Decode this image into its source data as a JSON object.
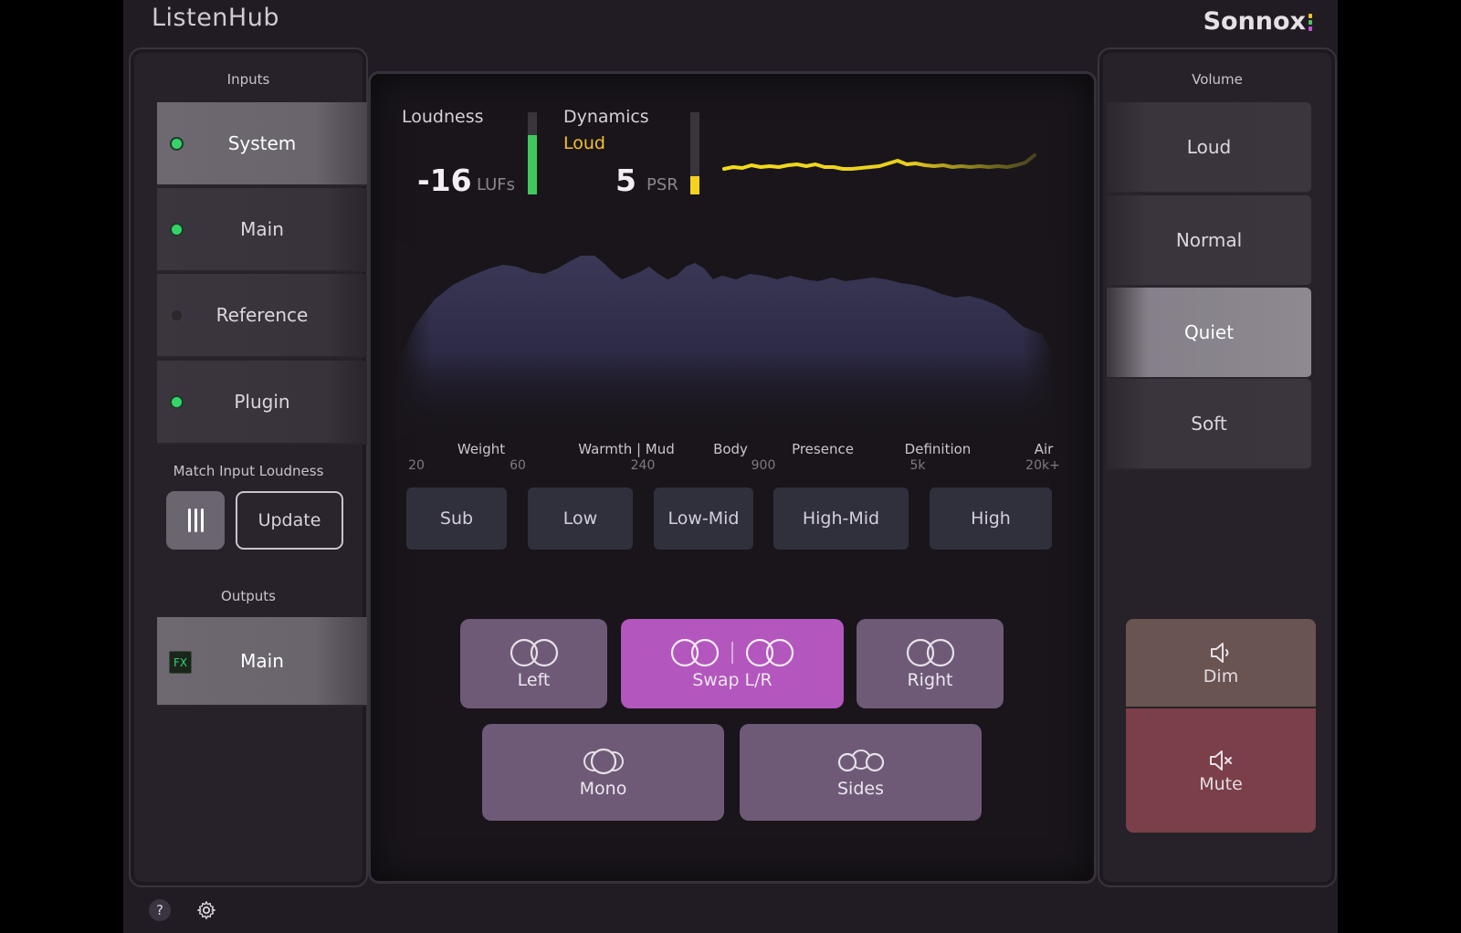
{
  "app": {
    "title": "ListenHub",
    "brand": "Sonnox",
    "brand_dot_colors": [
      "#f2c12e",
      "#4fc36a",
      "#c452d6"
    ]
  },
  "inputs": {
    "label": "Inputs",
    "items": [
      {
        "label": "System",
        "active": true,
        "indicator": "on"
      },
      {
        "label": "Main",
        "active": false,
        "indicator": "on"
      },
      {
        "label": "Reference",
        "active": false,
        "indicator": "off"
      },
      {
        "label": "Plugin",
        "active": false,
        "indicator": "on"
      }
    ]
  },
  "match": {
    "label": "Match Input Loudness",
    "update_label": "Update"
  },
  "outputs": {
    "label": "Outputs",
    "items": [
      {
        "label": "Main",
        "badge": "FX"
      }
    ]
  },
  "meters": {
    "loudness": {
      "label": "Loudness",
      "value": "-16",
      "unit": "LUFs",
      "level": 0.72,
      "color": "#3fc85c"
    },
    "dynamics": {
      "label": "Dynamics",
      "status": "Loud",
      "value": "5",
      "unit": "PSR",
      "level": 0.22,
      "color": "#f5d21c",
      "status_color": "#f2c12e"
    }
  },
  "spectrum": {
    "bands": [
      "Weight",
      "Warmth | Mud",
      "Body",
      "Presence",
      "Definition",
      "Air"
    ],
    "freqs": [
      "20",
      "60",
      "240",
      "900",
      "5k",
      "20k+"
    ]
  },
  "eq_buttons": [
    "Sub",
    "Low",
    "Low-Mid",
    "High-Mid",
    "High"
  ],
  "monitor": {
    "left": "Left",
    "swap": "Swap L/R",
    "right": "Right",
    "mono": "Mono",
    "sides": "Sides",
    "active": "swap"
  },
  "volume": {
    "label": "Volume",
    "items": [
      "Loud",
      "Normal",
      "Quiet",
      "Soft"
    ],
    "active": "Quiet",
    "dim": "Dim",
    "mute": "Mute"
  },
  "footer": {
    "help_icon": "help-icon",
    "settings_icon": "gear-icon"
  }
}
